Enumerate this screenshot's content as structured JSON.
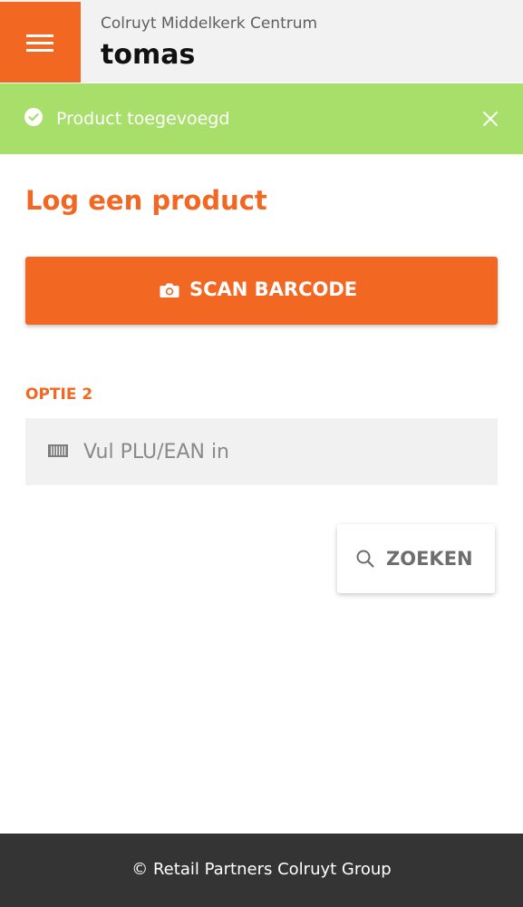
{
  "header": {
    "store_name": "Colruyt Middelkerk Centrum",
    "user_name": "tomas",
    "menu_icon": "hamburger-menu-icon"
  },
  "banner": {
    "message": "Product toegevoegd",
    "icon": "check-circle-icon",
    "close_icon": "close-icon",
    "color": "#a8df6b"
  },
  "main": {
    "title": "Log een product",
    "scan_button": {
      "label": "SCAN BARCODE",
      "icon": "camera-icon"
    },
    "option_label": "OPTIE 2",
    "code_input": {
      "placeholder": "Vul PLU/EAN in",
      "value": "",
      "icon": "barcode-icon"
    },
    "search_button": {
      "label": "ZOEKEN",
      "icon": "search-icon"
    }
  },
  "footer": {
    "text": "© Retail Partners Colruyt Group"
  },
  "colors": {
    "accent": "#f26722",
    "success": "#a8df6b",
    "footer_bg": "#343434"
  }
}
